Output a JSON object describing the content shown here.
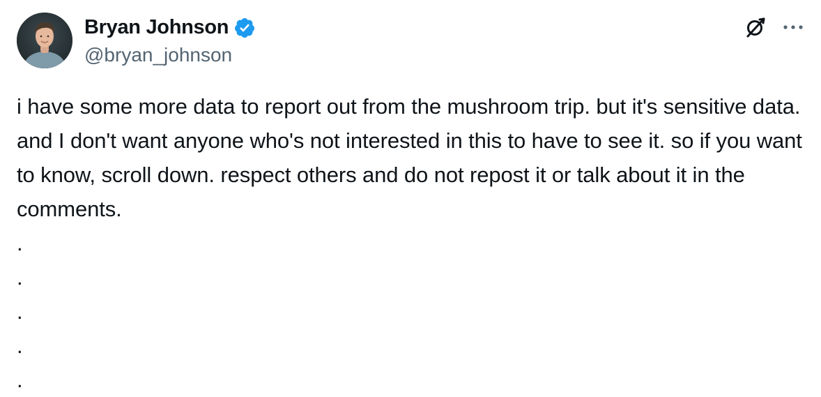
{
  "author": {
    "display_name": "Bryan Johnson",
    "handle": "@bryan_johnson",
    "verified": true,
    "avatar_icon": "avatar-photo"
  },
  "actions": {
    "grok_icon": "grok-icon",
    "more_icon": "more-horizontal-icon"
  },
  "tweet": {
    "text": "i have some more data to report out from the mushroom trip. but it's sensitive data. and I don't want anyone who's not interested in this to have to see it. so if you want to know, scroll down. respect others and do not repost it or talk about it in the comments.",
    "dots": [
      ".",
      ".",
      ".",
      ".",
      "."
    ]
  },
  "colors": {
    "verified_blue": "#1d9bf0",
    "secondary_text": "#536471",
    "primary_text": "#0f1419"
  }
}
